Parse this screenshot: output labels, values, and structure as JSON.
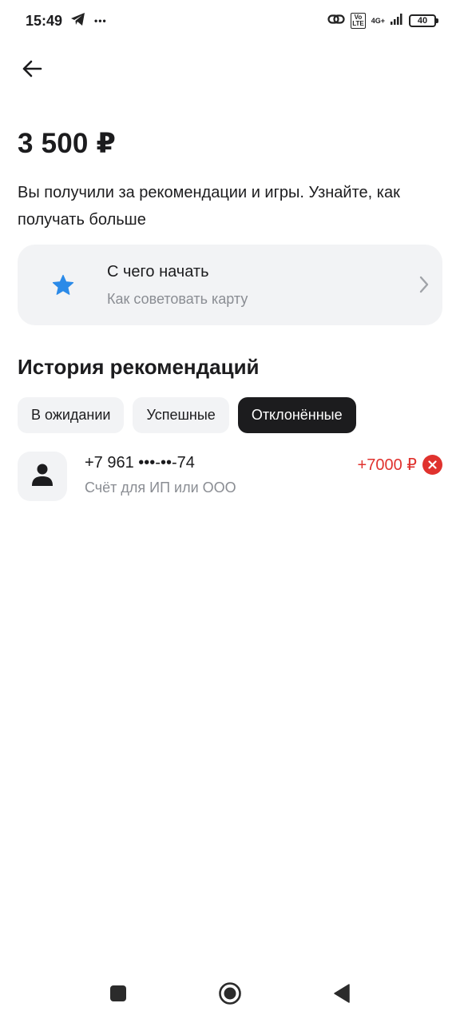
{
  "status_bar": {
    "time": "15:49",
    "more": "•••",
    "volte": "Vo\nLTE",
    "network": "4G+",
    "battery": "40",
    "icons": [
      "telegram-icon",
      "link-icon",
      "volte-icon",
      "signal-icon",
      "battery-icon"
    ]
  },
  "header": {
    "back_icon": "arrow-left-icon"
  },
  "balance": {
    "amount": "3 500 ₽",
    "description": "Вы получили за рекомендации и игры. Узнайте, как получать больше"
  },
  "start_card": {
    "title": "С чего начать",
    "subtitle": "Как советовать карту",
    "icon": "star-icon",
    "accent_color": "#2b8ae8"
  },
  "history": {
    "title": "История рекомендаций",
    "tabs": [
      {
        "label": "В ожидании",
        "active": false
      },
      {
        "label": "Успешные",
        "active": false
      },
      {
        "label": "Отклонённые",
        "active": true
      }
    ],
    "items": [
      {
        "phone": "+7 961 •••-••-74",
        "subtitle": "Счёт для ИП или ООО",
        "reward": "+7000 ₽",
        "status": "rejected",
        "status_color": "#e0322e"
      }
    ]
  },
  "nav_bar": {
    "icons": [
      "recent-apps-icon",
      "home-icon",
      "back-triangle-icon"
    ]
  }
}
